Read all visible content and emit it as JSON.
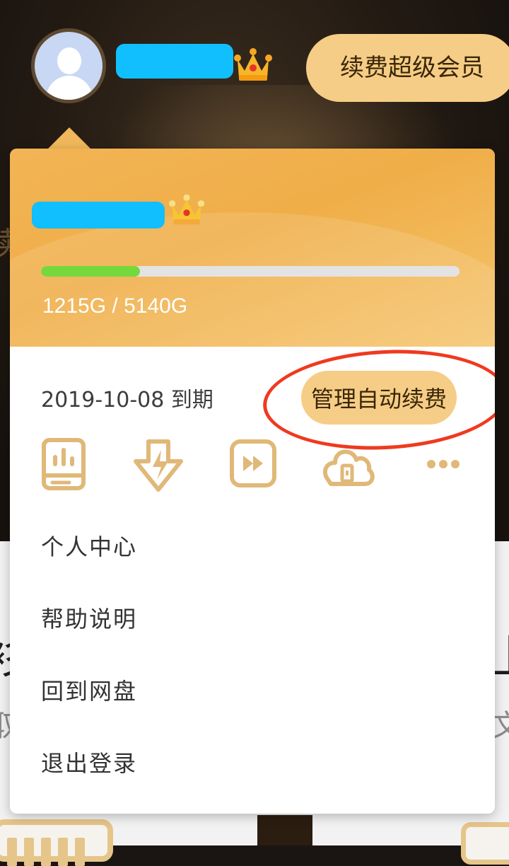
{
  "header": {
    "renew_button_label": "续费超级会员"
  },
  "account_card": {
    "storage": {
      "used_gb": 1215,
      "total_gb": 5140,
      "label": "1215G / 5140G",
      "bar_color": "#75d93b"
    },
    "expiry_text": "2019-10-08 到期",
    "manage_autorenew_label": "管理自动续费",
    "feature_icons": [
      "book-stats-icon",
      "fast-download-icon",
      "fast-forward-icon",
      "cloud-lock-icon",
      "more-icon"
    ]
  },
  "menu": {
    "items": [
      {
        "label": "个人中心"
      },
      {
        "label": "帮助说明"
      },
      {
        "label": "回到网盘"
      },
      {
        "label": "退出登录"
      }
    ]
  },
  "colors": {
    "accent_gold": "#f6cd86",
    "header_orange": "#f0ae48",
    "redaction_blue": "#11bfff",
    "annotation_red": "#ef3a1f",
    "icon_gold": "#e0b878"
  }
}
